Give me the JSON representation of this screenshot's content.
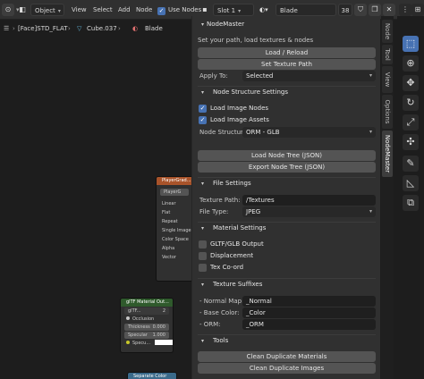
{
  "header": {
    "mode_label": "Object",
    "menus": [
      "View",
      "Select",
      "Add",
      "Node"
    ],
    "use_nodes_label": "Use Nodes",
    "slot_label": "Slot 1",
    "material_name": "Blade",
    "user_count": "38"
  },
  "breadcrumb": {
    "object": "[Face]STD_FLAT",
    "mesh": "Cube.037",
    "material": "Blade"
  },
  "nodes": {
    "player": {
      "title": "PlayerGrad...",
      "inner": "PlayerG",
      "options": [
        "Linear",
        "Flat",
        "Repeat",
        "Single Image"
      ],
      "outputs": [
        "Color Space",
        "Alpha",
        "Vector"
      ]
    },
    "gltf": {
      "title": "glTF Material Out...",
      "sub": "glTF...",
      "sub_count": "2",
      "rows": [
        {
          "label": "Occlusion",
          "value": ""
        },
        {
          "label": "Thickness",
          "value": "0.000"
        },
        {
          "label": "Specular",
          "value": "1.000"
        },
        {
          "label": "Specu...",
          "value": ""
        }
      ]
    },
    "separate": {
      "title": "Separate Color"
    }
  },
  "panel": {
    "title": "NodeMaster",
    "description": "Set your path, load textures & nodes",
    "load_reload": "Load / Reload",
    "set_texture_path": "Set Texture Path",
    "apply_to_label": "Apply To:",
    "apply_to_value": "Selected",
    "sections": {
      "node_structure": "Node Structure Settings",
      "file": "File Settings",
      "material": "Material Settings",
      "suffixes": "Texture Suffixes",
      "tools": "Tools"
    },
    "load_image_nodes": "Load Image Nodes",
    "load_image_assets": "Load Image Assets",
    "node_structure_label": "Node Structure:",
    "node_structure_value": "ORM - GLB",
    "load_node_tree": "Load Node Tree (JSON)",
    "export_node_tree": "Export Node Tree (JSON)",
    "texture_path_label": "Texture Path:",
    "texture_path_value": "/Textures",
    "file_type_label": "File Type:",
    "file_type_value": "JPEG",
    "gltf_output": "GLTF/GLB Output",
    "displacement": "Displacement",
    "tex_coord": "Tex Co-ord",
    "normal_label": "- Normal Map:",
    "normal_value": "_Normal",
    "base_color_label": "- Base Color:",
    "base_color_value": "_Color",
    "orm_label": "- ORM:",
    "orm_value": "_ORM",
    "clean_materials": "Clean Duplicate Materials",
    "clean_images": "Clean Duplicate Images"
  },
  "tabs": [
    "Node",
    "Tool",
    "View",
    "Options",
    "NodeMaster"
  ],
  "colors": {
    "accent": "#4772b3",
    "node_header_orange": "#a8532a",
    "node_header_green": "#2f5a2c",
    "node_header_blue": "#3a6a8a"
  }
}
